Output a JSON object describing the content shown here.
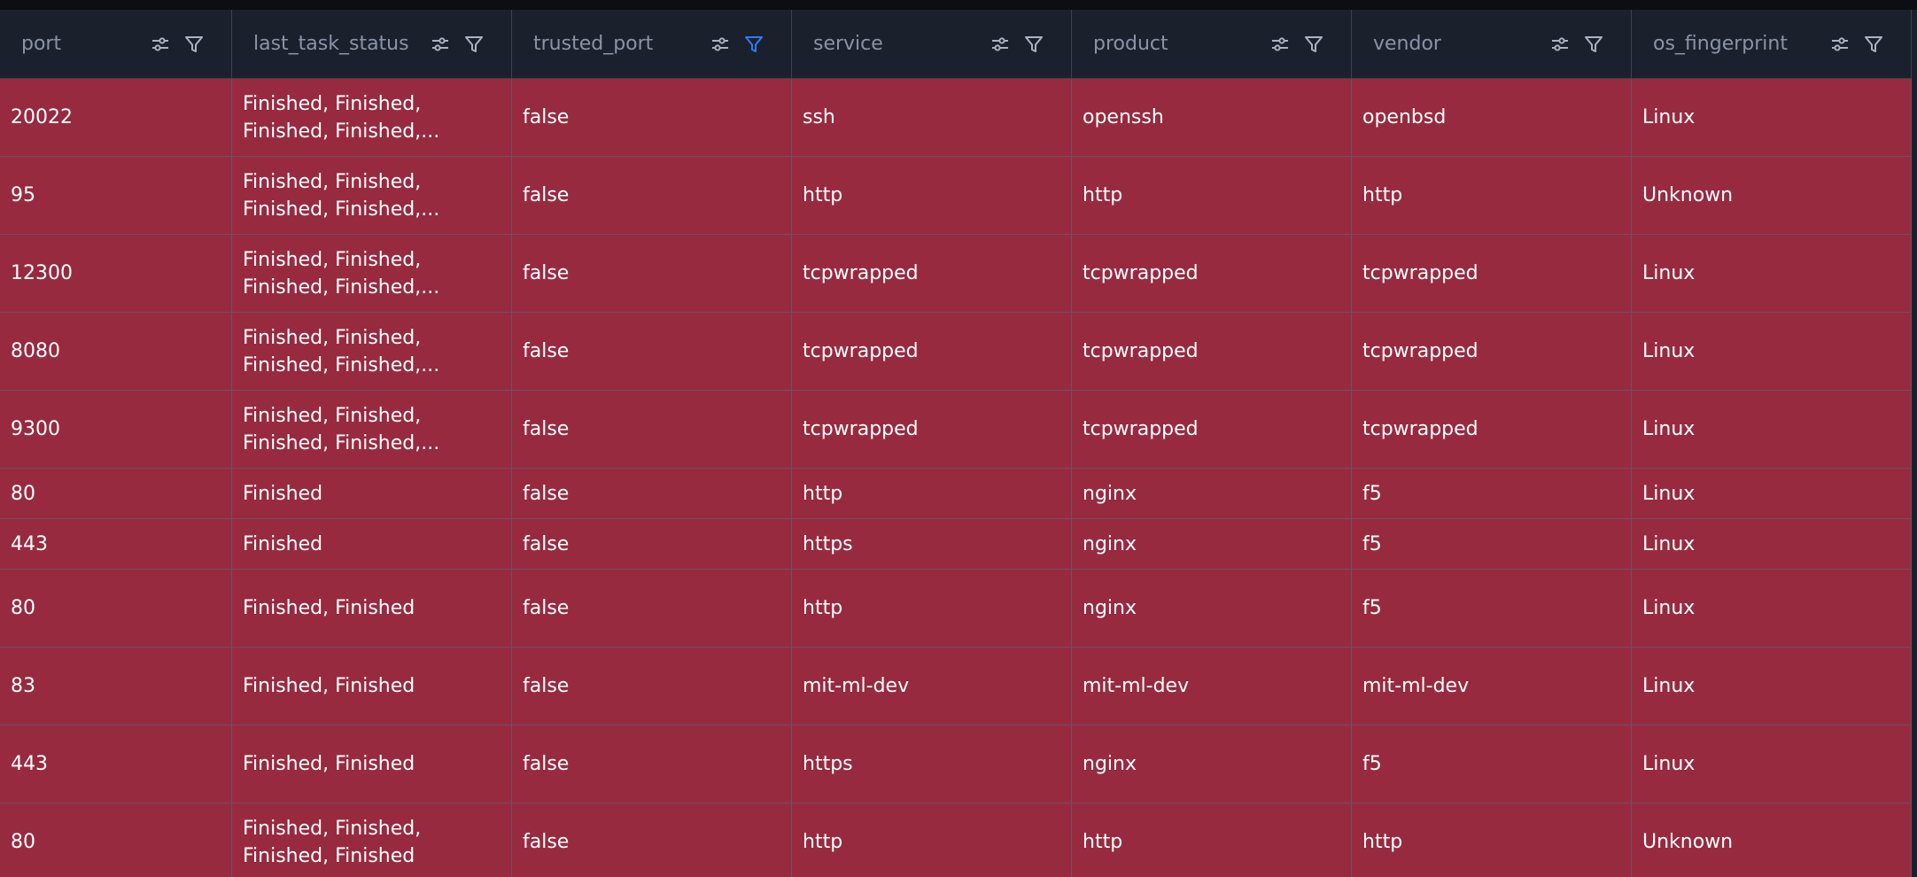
{
  "table": {
    "columns": [
      {
        "key": "port",
        "label": "port",
        "filter_active": false
      },
      {
        "key": "last_task_status",
        "label": "last_task_status",
        "filter_active": false
      },
      {
        "key": "trusted_port",
        "label": "trusted_port",
        "filter_active": true
      },
      {
        "key": "service",
        "label": "service",
        "filter_active": false
      },
      {
        "key": "product",
        "label": "product",
        "filter_active": false
      },
      {
        "key": "vendor",
        "label": "vendor",
        "filter_active": false
      },
      {
        "key": "os_fingerprint",
        "label": "os_fingerprint",
        "filter_active": false
      }
    ],
    "rows": [
      {
        "port": "20022",
        "last_task_status": "Finished, Finished, Finished, Finished,...",
        "trusted_port": "false",
        "service": "ssh",
        "product": "openssh",
        "vendor": "openbsd",
        "os_fingerprint": "Linux"
      },
      {
        "port": "95",
        "last_task_status": "Finished, Finished, Finished, Finished,...",
        "trusted_port": "false",
        "service": "http",
        "product": "http",
        "vendor": "http",
        "os_fingerprint": "Unknown"
      },
      {
        "port": "12300",
        "last_task_status": "Finished, Finished, Finished, Finished,...",
        "trusted_port": "false",
        "service": "tcpwrapped",
        "product": "tcpwrapped",
        "vendor": "tcpwrapped",
        "os_fingerprint": "Linux"
      },
      {
        "port": "8080",
        "last_task_status": "Finished, Finished, Finished, Finished,...",
        "trusted_port": "false",
        "service": "tcpwrapped",
        "product": "tcpwrapped",
        "vendor": "tcpwrapped",
        "os_fingerprint": "Linux"
      },
      {
        "port": "9300",
        "last_task_status": "Finished, Finished, Finished, Finished,...",
        "trusted_port": "false",
        "service": "tcpwrapped",
        "product": "tcpwrapped",
        "vendor": "tcpwrapped",
        "os_fingerprint": "Linux"
      },
      {
        "port": "80",
        "last_task_status": "Finished",
        "trusted_port": "false",
        "service": "http",
        "product": "nginx",
        "vendor": "f5",
        "os_fingerprint": "Linux"
      },
      {
        "port": "443",
        "last_task_status": "Finished",
        "trusted_port": "false",
        "service": "https",
        "product": "nginx",
        "vendor": "f5",
        "os_fingerprint": "Linux"
      },
      {
        "port": "80",
        "last_task_status": "Finished, Finished",
        "trusted_port": "false",
        "service": "http",
        "product": "nginx",
        "vendor": "f5",
        "os_fingerprint": "Linux"
      },
      {
        "port": "83",
        "last_task_status": "Finished, Finished",
        "trusted_port": "false",
        "service": "mit-ml-dev",
        "product": "mit-ml-dev",
        "vendor": "mit-ml-dev",
        "os_fingerprint": "Linux"
      },
      {
        "port": "443",
        "last_task_status": "Finished, Finished",
        "trusted_port": "false",
        "service": "https",
        "product": "nginx",
        "vendor": "f5",
        "os_fingerprint": "Linux"
      },
      {
        "port": "80",
        "last_task_status": "Finished, Finished, Finished, Finished",
        "trusted_port": "false",
        "service": "http",
        "product": "http",
        "vendor": "http",
        "os_fingerprint": "Unknown"
      }
    ]
  },
  "icons": {
    "column_settings": "sliders-icon",
    "column_filter": "filter-icon"
  },
  "colors": {
    "header_bg": "#1b212c",
    "header_text": "#8a94a6",
    "icon": "#aab3c2",
    "icon_active": "#2f7cf6",
    "row_bg": "#982a40",
    "row_text": "#ffffff",
    "grid_line": "#6e5064"
  }
}
